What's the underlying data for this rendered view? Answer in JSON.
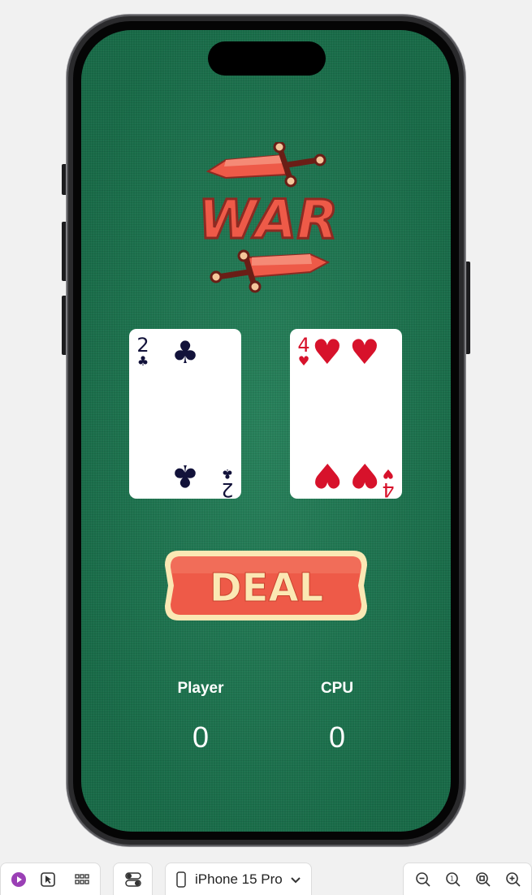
{
  "app": {
    "logo_text": "WAR",
    "deal_label": "DEAL",
    "player_card": {
      "rank": "2",
      "suit": "clubs",
      "suit_glyph": "♣",
      "color": "#12123a"
    },
    "cpu_card": {
      "rank": "4",
      "suit": "hearts",
      "suit_glyph": "♥",
      "color": "#d7122b"
    },
    "player_label": "Player",
    "cpu_label": "CPU",
    "player_score": "0",
    "cpu_score": "0",
    "table_color": "#1c7a52",
    "accent_color": "#ee5a48"
  },
  "toolbar": {
    "live_preview_icon": "play-icon",
    "selectable_icon": "pointer-icon",
    "variants_icon": "grid-icon",
    "settings_icon": "toggles-icon",
    "device_icon": "iphone-icon",
    "device_name": "iPhone 15 Pro",
    "zoom_out_icon": "zoom-out-icon",
    "zoom_actual_icon": "zoom-100-icon",
    "zoom_fit_icon": "zoom-fit-icon",
    "zoom_in_icon": "zoom-in-icon"
  }
}
